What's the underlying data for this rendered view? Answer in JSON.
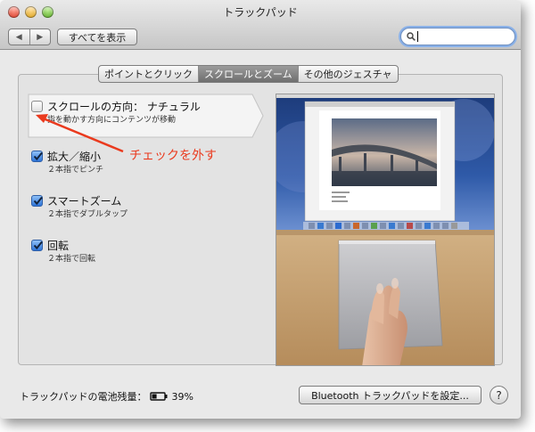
{
  "window": {
    "title": "トラックパッド"
  },
  "toolbar": {
    "back_glyph": "◀",
    "forward_glyph": "▶",
    "show_all_label": "すべてを表示"
  },
  "search": {
    "value": "",
    "icon": "magnifier-icon"
  },
  "tabs": [
    {
      "label": "ポイントとクリック",
      "selected": false
    },
    {
      "label": "スクロールとズーム",
      "selected": true
    },
    {
      "label": "その他のジェスチャ",
      "selected": false
    }
  ],
  "options": [
    {
      "title": "スクロールの方向： ナチュラル",
      "desc": "指を動かす方向にコンテンツが移動",
      "checked": false
    },
    {
      "title": "拡大／縮小",
      "desc": "２本指でピンチ",
      "checked": true
    },
    {
      "title": "スマートズーム",
      "desc": "２本指でダブルタップ",
      "checked": true
    },
    {
      "title": "回転",
      "desc": "２本指で回転",
      "checked": true
    }
  ],
  "annotation": {
    "text": "チェックを外す",
    "color": "#ea3a1e"
  },
  "footer": {
    "battery_label": "トラックパッドの電池残量：",
    "battery_percent": "39%",
    "battery_level": 0.39,
    "bluetooth_button": "Bluetooth トラックパッドを設定...",
    "help_glyph": "?"
  },
  "colors": {
    "checkbox_blue": "#2d73d8",
    "selected_tab": "#7a7a7a",
    "search_focus": "#8ab1e8"
  }
}
